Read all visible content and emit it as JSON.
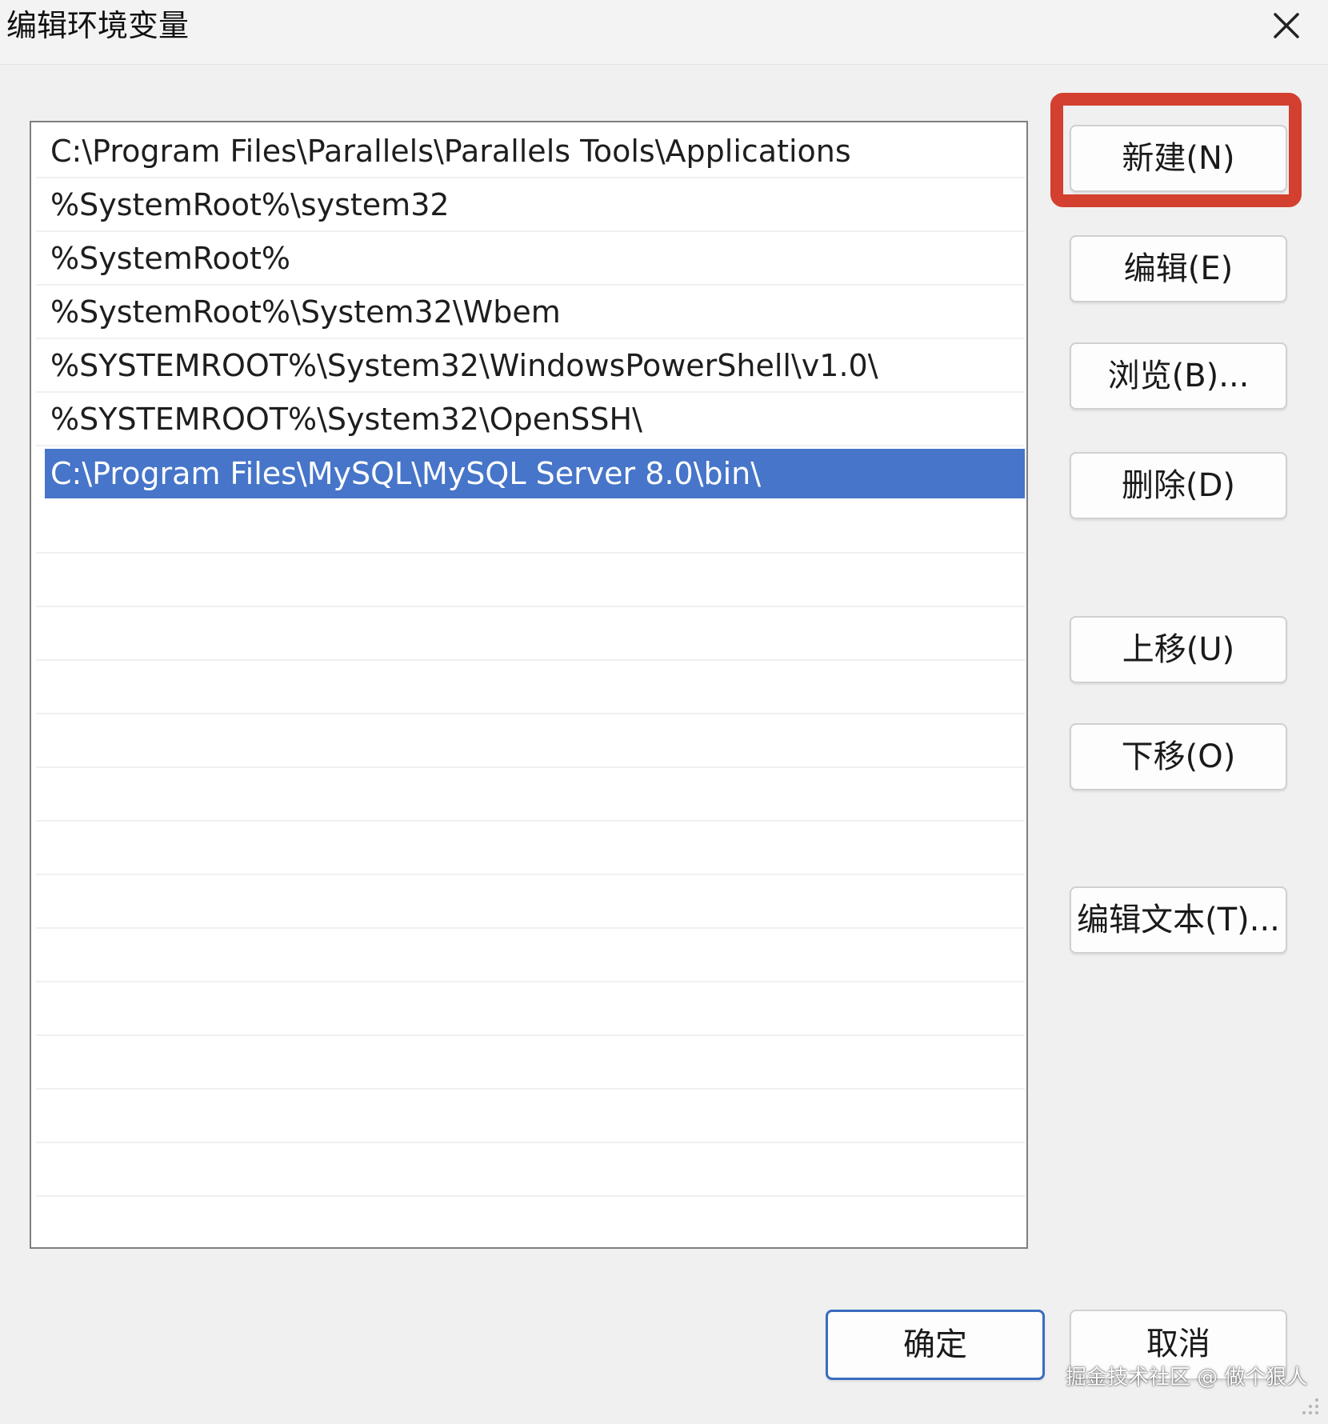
{
  "window": {
    "title": "编辑环境变量",
    "close_icon": "close-icon"
  },
  "path_list": {
    "items": [
      "C:\\Program Files\\Parallels\\Parallels Tools\\Applications",
      "%SystemRoot%\\system32",
      "%SystemRoot%",
      "%SystemRoot%\\System32\\Wbem",
      "%SYSTEMROOT%\\System32\\WindowsPowerShell\\v1.0\\",
      "%SYSTEMROOT%\\System32\\OpenSSH\\",
      "C:\\Program Files\\MySQL\\MySQL Server 8.0\\bin\\"
    ],
    "selected_index": 6
  },
  "buttons": {
    "new": "新建(N)",
    "edit": "编辑(E)",
    "browse": "浏览(B)...",
    "delete": "删除(D)",
    "move_up": "上移(U)",
    "move_down": "下移(O)",
    "edit_text": "编辑文本(T)...",
    "ok": "确定",
    "cancel": "取消"
  },
  "annotation": {
    "highlight_target": "新建(N)",
    "color": "#d3402f"
  },
  "watermark": "掘金技术社区 @ 做个狠人",
  "colors": {
    "selection": "#4675c9",
    "primary_border": "#3a6cc0"
  }
}
